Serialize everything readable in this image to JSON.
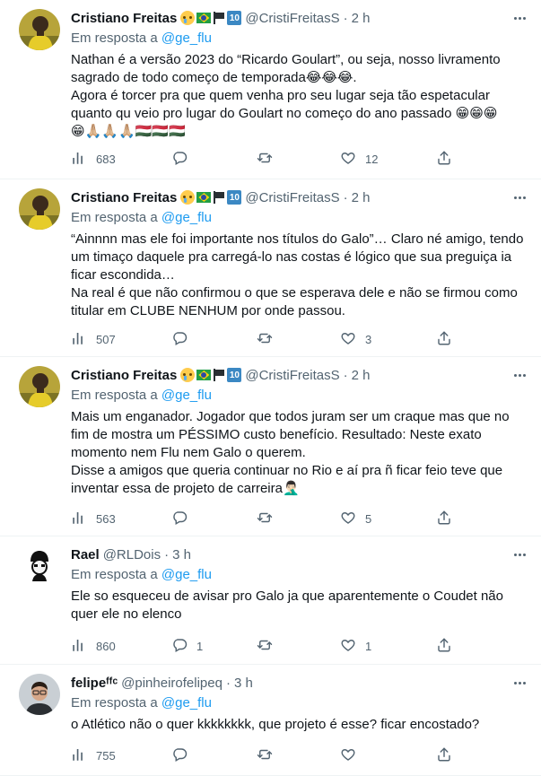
{
  "colors": {
    "accent": "#1d9bf0",
    "secondary": "#536471",
    "text": "#0f1419",
    "divider": "#eff3f4"
  },
  "icons": [
    "views-icon",
    "reply-icon",
    "retweet-icon",
    "like-icon",
    "share-icon",
    "more-icon"
  ],
  "tweets": [
    {
      "name": "Cristiano Freitas",
      "handle": "@CristiFreitasS",
      "time": "2 h",
      "reply_prefix": "Em resposta a ",
      "reply_mention": "@ge_flu",
      "text": "Nathan é a versão 2023 do “Ricardo Goulart”, ou seja, nosso livramento sagrado de todo começo de temporada😂😂😂.\nAgora é torcer pra que quem venha pro seu lugar seja tão espetacular quanto qu veio pro lugar do Goulart no começo do ano passado 😁😁😁\n😁🙏🏼🙏🏼🙏🏼🇭🇺🇭🇺🇭🇺",
      "views": "683",
      "replies": "",
      "retweets": "",
      "likes": "12"
    },
    {
      "name": "Cristiano Freitas",
      "handle": "@CristiFreitasS",
      "time": "2 h",
      "reply_prefix": "Em resposta a ",
      "reply_mention": "@ge_flu",
      "text": "“Ainnnn mas ele foi importante nos títulos do Galo”… Claro né amigo, tendo um timaço daquele pra carregá-lo nas costas é lógico que sua preguiça ia ficar escondida…\nNa real é que não confirmou o que se esperava dele e não se firmou como titular em CLUBE NENHUM por onde passou.",
      "views": "507",
      "replies": "",
      "retweets": "",
      "likes": "3"
    },
    {
      "name": "Cristiano Freitas",
      "handle": "@CristiFreitasS",
      "time": "2 h",
      "reply_prefix": "Em resposta a ",
      "reply_mention": "@ge_flu",
      "text": "Mais um enganador. Jogador que todos juram ser um craque mas que no fim de mostra um PÉSSIMO custo benefício. Resultado: Neste exato momento nem Flu nem Galo o querem.\nDisse a amigos que queria continuar no Rio e aí pra ñ ficar feio teve que inventar essa de projeto de carreira🤦🏻‍♂️",
      "views": "563",
      "replies": "",
      "retweets": "",
      "likes": "5"
    },
    {
      "name": "Rael",
      "handle": "@RLDois",
      "time": "3 h",
      "reply_prefix": "Em resposta a ",
      "reply_mention": "@ge_flu",
      "text": "Ele so esqueceu de avisar pro Galo ja que aparentemente o Coudet não quer ele no elenco",
      "views": "860",
      "replies": "1",
      "retweets": "",
      "likes": "1"
    },
    {
      "name": "felipeᶠᶠᶜ",
      "handle": "@pinheirofelipeq",
      "time": "3 h",
      "reply_prefix": "Em resposta a ",
      "reply_mention": "@ge_flu",
      "text": "o Atlético não o quer kkkkkkkk, que projeto é esse? ficar encostado?",
      "views": "755",
      "replies": "",
      "retweets": "",
      "likes": ""
    }
  ]
}
